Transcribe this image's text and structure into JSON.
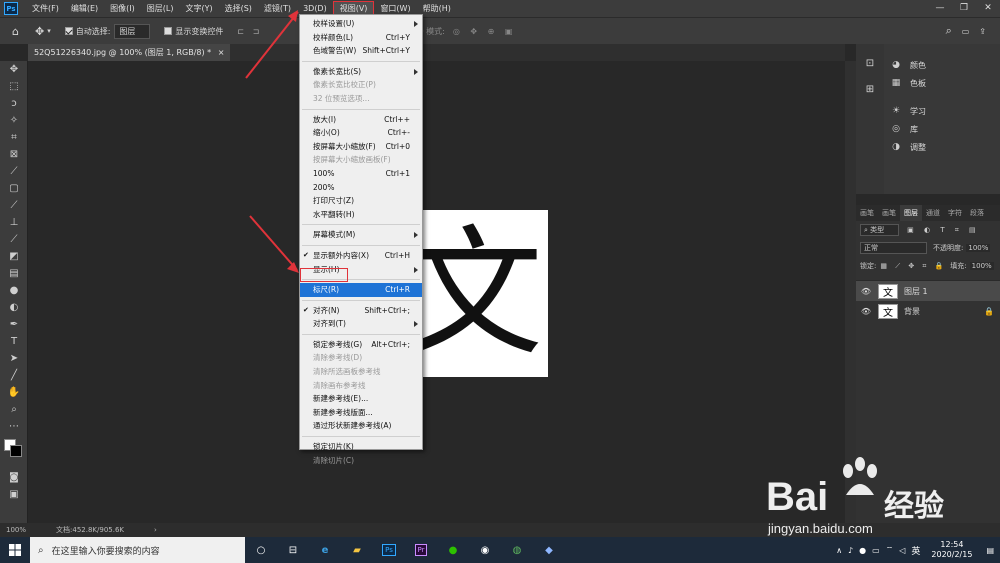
{
  "menubar": {
    "app_icon": "Ps",
    "items": [
      "文件(F)",
      "编辑(E)",
      "图像(I)",
      "图层(L)",
      "文字(Y)",
      "选择(S)",
      "滤镜(T)",
      "3D(D)",
      "视图(V)",
      "窗口(W)",
      "帮助(H)"
    ],
    "active_index": 8,
    "window_controls": [
      "—",
      "❐",
      "✕"
    ]
  },
  "options": {
    "auto_select_label": "自动选择:",
    "auto_select_value": "图层",
    "show_transform_label": "显示变换控件",
    "mode3d_label": "3D 模式:"
  },
  "document": {
    "tab_title": "52Q51226340.jpg @ 100% (图层 1, RGB/8) *",
    "tab_close": "×",
    "glyph": "文"
  },
  "view_menu": {
    "items": [
      {
        "label": "校样设置(U)",
        "shortcut": "",
        "type": "sub",
        "disabled": false
      },
      {
        "label": "校样颜色(L)",
        "shortcut": "Ctrl+Y",
        "disabled": false
      },
      {
        "label": "色域警告(W)",
        "shortcut": "Shift+Ctrl+Y",
        "disabled": false
      },
      {
        "sep": true
      },
      {
        "label": "像素长宽比(S)",
        "shortcut": "",
        "type": "sub",
        "disabled": false
      },
      {
        "label": "像素长宽比校正(P)",
        "shortcut": "",
        "disabled": true
      },
      {
        "label": "32 位预览选项...",
        "shortcut": "",
        "disabled": true
      },
      {
        "sep": true
      },
      {
        "label": "放大(I)",
        "shortcut": "Ctrl++",
        "disabled": false
      },
      {
        "label": "缩小(O)",
        "shortcut": "Ctrl+-",
        "disabled": false
      },
      {
        "label": "按屏幕大小缩放(F)",
        "shortcut": "Ctrl+0",
        "disabled": false
      },
      {
        "label": "按屏幕大小缩放画板(F)",
        "shortcut": "",
        "disabled": true
      },
      {
        "label": "100%",
        "shortcut": "Ctrl+1",
        "disabled": false
      },
      {
        "label": "200%",
        "shortcut": "",
        "disabled": false
      },
      {
        "label": "打印尺寸(Z)",
        "shortcut": "",
        "disabled": false
      },
      {
        "label": "水平翻转(H)",
        "shortcut": "",
        "disabled": false
      },
      {
        "sep": true
      },
      {
        "label": "屏幕模式(M)",
        "shortcut": "",
        "type": "sub",
        "disabled": false
      },
      {
        "sep": true
      },
      {
        "label": "显示额外内容(X)",
        "shortcut": "Ctrl+H",
        "checked": true,
        "disabled": false
      },
      {
        "label": "显示(H)",
        "shortcut": "",
        "type": "sub",
        "disabled": false
      },
      {
        "sep": true
      },
      {
        "label": "标尺(R)",
        "shortcut": "Ctrl+R",
        "highlighted": true,
        "disabled": false
      },
      {
        "sep": true
      },
      {
        "label": "对齐(N)",
        "shortcut": "Shift+Ctrl+;",
        "checked": true,
        "disabled": false
      },
      {
        "label": "对齐到(T)",
        "shortcut": "",
        "type": "sub",
        "disabled": false
      },
      {
        "sep": true
      },
      {
        "label": "锁定参考线(G)",
        "shortcut": "Alt+Ctrl+;",
        "disabled": false
      },
      {
        "label": "清除参考线(D)",
        "shortcut": "",
        "disabled": true
      },
      {
        "label": "清除所选画板参考线",
        "shortcut": "",
        "disabled": true
      },
      {
        "label": "清除画布参考线",
        "shortcut": "",
        "disabled": true
      },
      {
        "label": "新建参考线(E)...",
        "shortcut": "",
        "disabled": false
      },
      {
        "label": "新建参考线版面...",
        "shortcut": "",
        "disabled": false
      },
      {
        "label": "通过形状新建参考线(A)",
        "shortcut": "",
        "disabled": false
      },
      {
        "sep": true
      },
      {
        "label": "锁定切片(K)",
        "shortcut": "",
        "disabled": false
      },
      {
        "label": "清除切片(C)",
        "shortcut": "",
        "disabled": true
      }
    ]
  },
  "right_panel": {
    "items": [
      {
        "icon": "palette-icon",
        "label": "颜色"
      },
      {
        "icon": "swatches-icon",
        "label": "色板"
      },
      {
        "icon": "bulb-icon",
        "label": "学习"
      },
      {
        "icon": "library-icon",
        "label": "库"
      },
      {
        "icon": "adjust-icon",
        "label": "调整"
      }
    ]
  },
  "layers": {
    "tabs": [
      "画笔",
      "画笔",
      "图层",
      "通道",
      "字符",
      "段落"
    ],
    "active_tab": 2,
    "filter": "类型",
    "blend_mode": "正常",
    "opacity_label": "不透明度:",
    "opacity": "100%",
    "lock_label": "锁定:",
    "fill_label": "填充:",
    "fill": "100%",
    "list": [
      {
        "name": "图层 1",
        "thumb": "文",
        "selected": true,
        "locked": false
      },
      {
        "name": "背景",
        "thumb": "文",
        "selected": false,
        "locked": true
      }
    ]
  },
  "status": {
    "zoom": "100%",
    "doc": "文档:452.8K/905.6K"
  },
  "taskbar": {
    "search_placeholder": "在这里输入你要搜索的内容",
    "ime": "英",
    "time": "12:54",
    "date": "2020/2/15"
  },
  "watermark": {
    "brand": "Bai",
    "brand2": "经验",
    "url": "jingyan.baidu.com"
  },
  "colors": {
    "accent": "#1e73d6",
    "highlight_border": "#e0333a",
    "bg": "#282828",
    "panel": "#3c3c3c"
  }
}
